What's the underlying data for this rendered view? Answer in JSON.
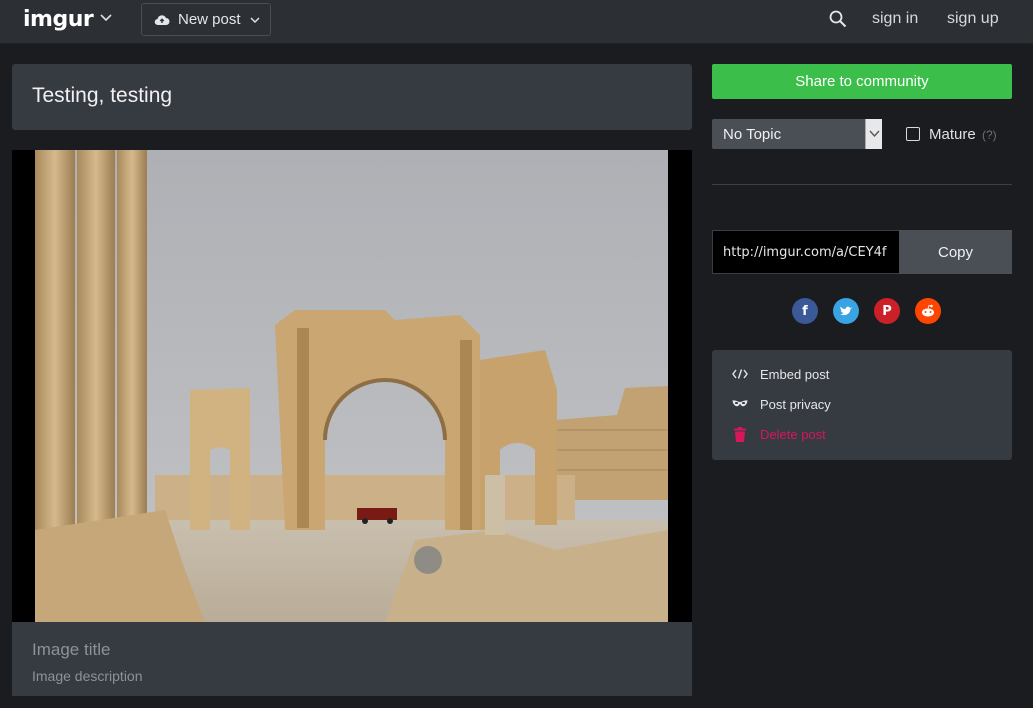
{
  "header": {
    "logo": "imgur",
    "new_post_label": "New post",
    "sign_in": "sign in",
    "sign_up": "sign up"
  },
  "post": {
    "title": "Testing, testing",
    "image_title_placeholder": "Image title",
    "image_description_placeholder": "Image description"
  },
  "sidebar": {
    "share_label": "Share to community",
    "topic_selected": "No Topic",
    "mature_label": "Mature",
    "mature_help": "(?)",
    "share_link": "http://imgur.com/a/CEY4f",
    "copy_label": "Copy",
    "social": [
      "facebook",
      "twitter",
      "pinterest",
      "reddit"
    ],
    "actions": [
      {
        "label": "Embed post",
        "icon": "code-icon"
      },
      {
        "label": "Post privacy",
        "icon": "mask-icon"
      },
      {
        "label": "Delete post",
        "icon": "trash-icon"
      }
    ]
  },
  "colors": {
    "share_green": "#3bbf4a",
    "delete_pink": "#d8175b",
    "facebook": "#3b5998",
    "twitter": "#3aa3e3",
    "pinterest": "#cb2027",
    "reddit": "#ff4500"
  }
}
